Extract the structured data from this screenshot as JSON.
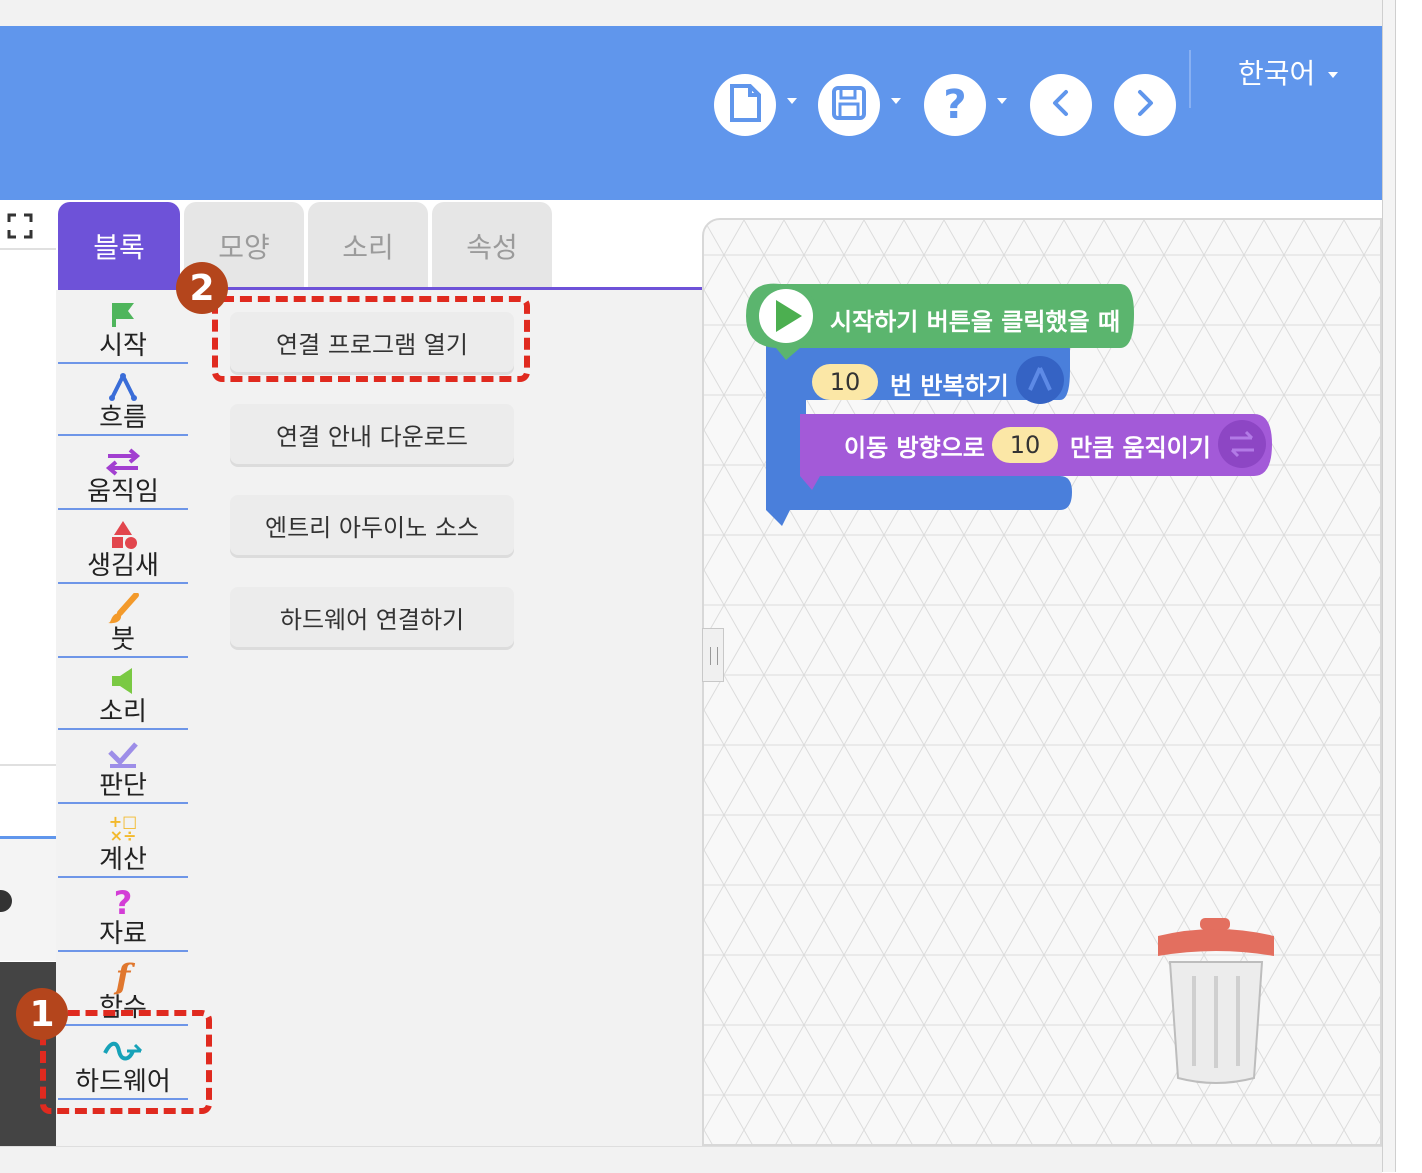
{
  "header": {
    "language": "한국어",
    "colors": {
      "header_bg": "#6096ec",
      "tab_active": "#6e52d8"
    },
    "icons": [
      "new-file-icon",
      "save-icon",
      "help-icon",
      "undo-icon",
      "redo-icon"
    ]
  },
  "tabs": [
    {
      "label": "블록",
      "active": true
    },
    {
      "label": "모양",
      "active": false
    },
    {
      "label": "소리",
      "active": false
    },
    {
      "label": "속성",
      "active": false
    }
  ],
  "categories": [
    {
      "label": "시작",
      "icon": "flag-icon"
    },
    {
      "label": "흐름",
      "icon": "flow-icon"
    },
    {
      "label": "움직임",
      "icon": "move-arrows-icon"
    },
    {
      "label": "생김새",
      "icon": "shapes-icon"
    },
    {
      "label": "붓",
      "icon": "brush-icon"
    },
    {
      "label": "소리",
      "icon": "speaker-icon"
    },
    {
      "label": "판단",
      "icon": "check-icon"
    },
    {
      "label": "계산",
      "icon": "calc-icon"
    },
    {
      "label": "자료",
      "icon": "question-icon"
    },
    {
      "label": "함수",
      "icon": "function-icon"
    },
    {
      "label": "하드웨어",
      "icon": "hardware-icon"
    }
  ],
  "menu": {
    "items": [
      "연결 프로그램 열기",
      "연결 안내 다운로드",
      "엔트리 아두이노 소스",
      "하드웨어 연결하기"
    ]
  },
  "annotations": {
    "badge1": "1",
    "badge2": "2"
  },
  "script": {
    "start_block": "시작하기 버튼을 클릭했을 때",
    "repeat_count": "10",
    "repeat_label": "번 반복하기",
    "move_label_before": "이동 방향으로",
    "move_count": "10",
    "move_label_after": "만큼 움직이기"
  }
}
